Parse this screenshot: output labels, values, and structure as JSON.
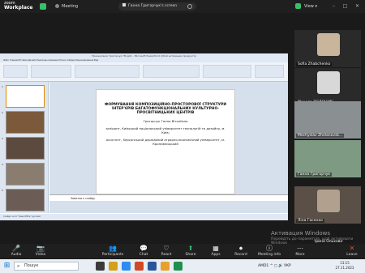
{
  "topbar": {
    "logo_line1": "zoom",
    "logo_line2": "Workplace",
    "meeting_label": "Meeting",
    "share_label": "Ганна Григорчук's screen",
    "view_label": "View"
  },
  "powerpoint": {
    "window_title": "Презентація Григорчук ГВ.pptx - Microsoft PowerPoint (Сбой активации продукта)",
    "tabs": "Файл  Главная  Вставка  Дизайн  Переходы  Анимация  Показ слайдов  Рецензирование  Вид",
    "notes_placeholder": "Заметки к слайду",
    "status": "Слайд 1 из 6  \"Тема Office\"  русский",
    "slide": {
      "title": "ФОРМУВАННЯ КОМПОЗИЦІЙНО-ПРОСТОРОВОЇ СТРУКТУРИ ІНТЕР'ЄРІВ БАГАТОФУНКЦІОНАЛЬНИХ КУЛЬТУРНО-ПРОСВІТНИЦЬКИХ ЦЕНТРІВ",
      "author": "Григорчук Ганна Віталіївна",
      "affil1": "аспірант, Київський національний університет технологій та дизайну, м. Київ;",
      "affil2": "асистент, Херсонський державний аграрно-економічний університет, м. Кропивницький"
    },
    "thumb_numbers": [
      "1",
      "2",
      "3",
      "4",
      "5"
    ]
  },
  "participants": [
    {
      "name": "Sofia Zhabchenko"
    },
    {
      "name": "Микола ВОЛОШИН"
    },
    {
      "name": "Mechyslav Zhelanovsk..."
    },
    {
      "name": "Ганна Григорчук"
    },
    {
      "name": "Ліна Гасенко"
    },
    {
      "name": "Ірина Ольхова"
    }
  ],
  "activation": {
    "line1": "Активация Windows",
    "line2": "Перейдіть до параметрів, щоб активувати Windows"
  },
  "toolbar": [
    {
      "label": "Audio",
      "icon": "🎤"
    },
    {
      "label": "Video",
      "icon": "📷"
    },
    {
      "label": "Participants",
      "icon": "👥",
      "count": "16"
    },
    {
      "label": "Chat",
      "icon": "💬"
    },
    {
      "label": "React",
      "icon": "♡"
    },
    {
      "label": "Share",
      "icon": "⬆"
    },
    {
      "label": "Apps",
      "icon": "▦"
    },
    {
      "label": "Record",
      "icon": "⏺"
    },
    {
      "label": "Meeting info",
      "icon": "ⓘ"
    },
    {
      "label": "More",
      "icon": "⋯"
    },
    {
      "label": "Leave",
      "icon": "✕"
    }
  ],
  "taskbar": {
    "search_placeholder": "Пошук",
    "tray": "AMD1  ^  ◻  🔊 УКР",
    "time": "13:15",
    "date": "27.11.2023"
  }
}
